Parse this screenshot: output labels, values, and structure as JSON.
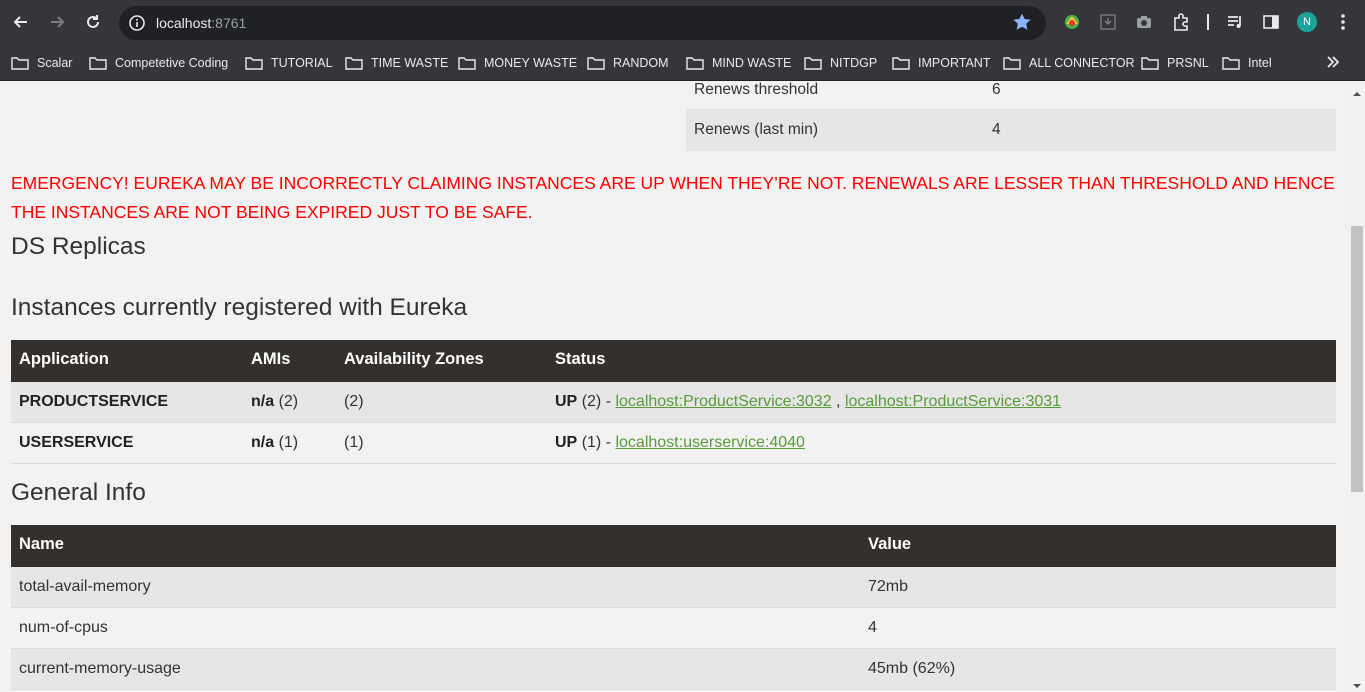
{
  "browser": {
    "url_host": "localhost",
    "url_port": ":8761",
    "profile_initial": "N",
    "bookmarks": [
      "Scalar",
      "Competetive Coding",
      "TUTORIAL",
      "TIME WASTE",
      "MONEY WASTE",
      "RANDOM",
      "MIND WASTE",
      "NITDGP",
      "IMPORTANT",
      "ALL CONNECTOR",
      "PRSNL",
      "Intel"
    ],
    "icons": [
      "back-icon",
      "forward-icon",
      "reload-icon",
      "site-info-icon",
      "bookmark-star-icon",
      "extension-icon",
      "download-icon",
      "camera-icon",
      "puzzle-icon",
      "media-icon",
      "side-panel-icon",
      "menu-icon",
      "folder-icon",
      "chevron-double-right-icon"
    ],
    "accent_color": "#8ab4f8"
  },
  "status": {
    "rows": [
      {
        "key": "Renews threshold",
        "value": "6"
      },
      {
        "key": "Renews (last min)",
        "value": "4"
      }
    ]
  },
  "emergency": {
    "text": "EMERGENCY! EUREKA MAY BE INCORRECTLY CLAIMING INSTANCES ARE UP WHEN THEY’RE NOT. RENEWALS ARE LESSER THAN THRESHOLD AND HENCE THE INSTANCES ARE NOT BEING EXPIRED JUST TO BE SAFE.",
    "color": "#ff0000"
  },
  "replicas": {
    "title": "DS Replicas"
  },
  "instances": {
    "title": "Instances currently registered with Eureka",
    "headers": [
      "Application",
      "AMIs",
      "Availability Zones",
      "Status"
    ],
    "rows": [
      {
        "app": "PRODUCTSERVICE",
        "ami_bold": "n/a",
        "ami_count": "(2)",
        "zones": "(2)",
        "status_bold": "UP",
        "status_count": "(2) -",
        "links": [
          "localhost:ProductService:3032",
          "localhost:ProductService:3031"
        ],
        "link_sep": ","
      },
      {
        "app": "USERSERVICE",
        "ami_bold": "n/a",
        "ami_count": "(1)",
        "zones": "(1)",
        "status_bold": "UP",
        "status_count": "(1) -",
        "links": [
          "localhost:userservice:4040"
        ]
      }
    ],
    "link_color": "#5a9b3a",
    "header_bg": "#34302d"
  },
  "general": {
    "title": "General Info",
    "headers": [
      "Name",
      "Value"
    ],
    "rows": [
      {
        "name": "total-avail-memory",
        "value": "72mb"
      },
      {
        "name": "num-of-cpus",
        "value": "4"
      },
      {
        "name": "current-memory-usage",
        "value": "45mb (62%)"
      }
    ]
  }
}
